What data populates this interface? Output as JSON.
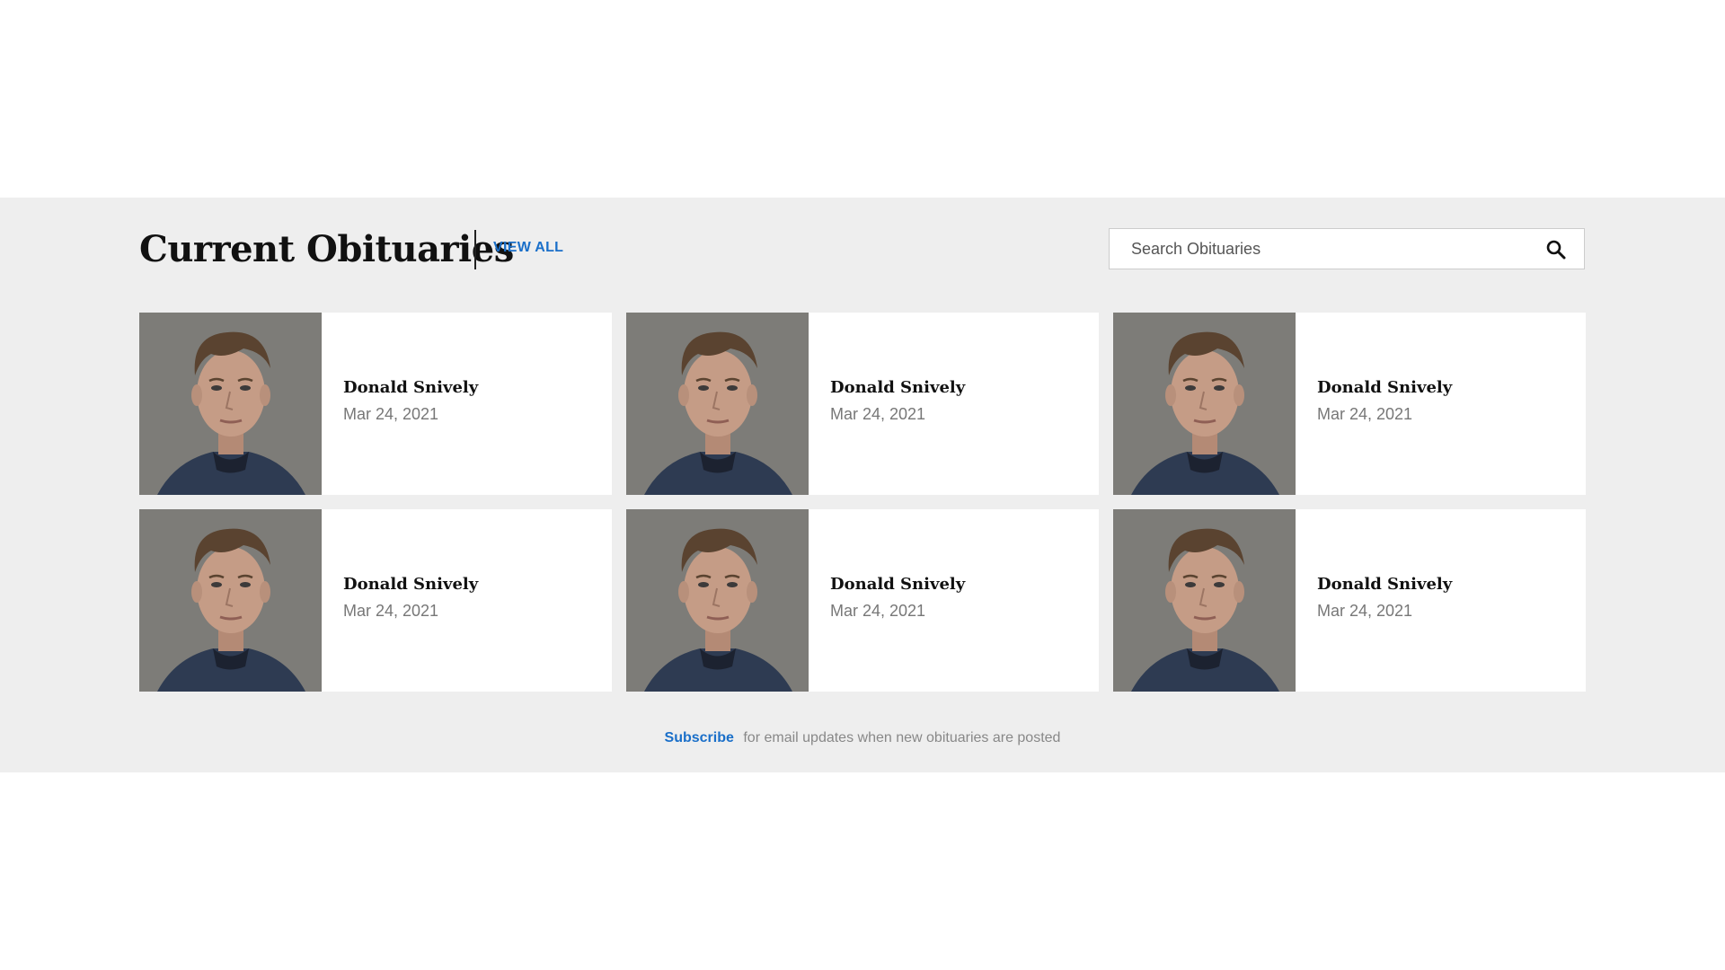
{
  "section": {
    "title": "Current Obituaries",
    "view_all_label": "VIEW ALL"
  },
  "search": {
    "placeholder": "Search Obituaries",
    "icon": "search-icon"
  },
  "obituaries": [
    {
      "name": "Donald Snively",
      "date": "Mar 24, 2021"
    },
    {
      "name": "Donald Snively",
      "date": "Mar 24, 2021"
    },
    {
      "name": "Donald Snively",
      "date": "Mar 24, 2021"
    },
    {
      "name": "Donald Snively",
      "date": "Mar 24, 2021"
    },
    {
      "name": "Donald Snively",
      "date": "Mar 24, 2021"
    },
    {
      "name": "Donald Snively",
      "date": "Mar 24, 2021"
    }
  ],
  "footer": {
    "subscribe_label": "Subscribe",
    "subscribe_text": "for email updates when new obituaries are posted"
  },
  "colors": {
    "accent": "#1a6fc9",
    "section_background": "#eeeeee",
    "card_background": "#ffffff"
  }
}
